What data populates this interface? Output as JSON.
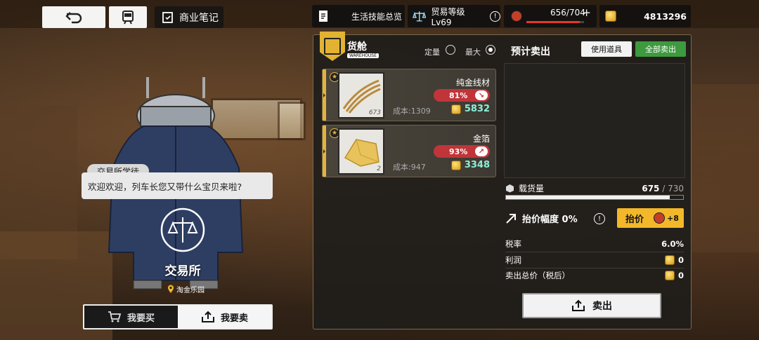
{
  "nav": {
    "back_icon": "undo-arrow-icon",
    "train_icon": "train-icon",
    "notes_label": "商业笔记"
  },
  "topbar": {
    "life_skills": "生活技能总览",
    "trade_level": "贸易等级Lv69",
    "fatigue_text": "656/704",
    "fatigue_fraction": 0.93,
    "currency": "4813296"
  },
  "character": {
    "speaker": "交易所学徒",
    "dialogue": "欢迎欢迎，列车长您又带什么宝贝来啦?",
    "station_name": "交易所",
    "location": "淘金乐园"
  },
  "mode": {
    "buy_label": "我要买",
    "sell_label": "我要卖",
    "active": "sell"
  },
  "warehouse": {
    "title": "货舱",
    "subtitle": "WAREHOUSE",
    "fixed_label": "定量",
    "max_label": "最大",
    "selected_radio": "最大"
  },
  "items": [
    {
      "name": "纯金线材",
      "quantity": "673",
      "pct": "81%",
      "trend": "down",
      "cost": "成本:1309",
      "price": "5832"
    },
    {
      "name": "金箔",
      "quantity": "2",
      "pct": "93%",
      "trend": "up",
      "cost": "成本:947",
      "price": "3348"
    }
  ],
  "sale": {
    "preview_title": "预计卖出",
    "use_item_label": "使用道具",
    "sell_all_label": "全部卖出",
    "cargo_label": "载货量",
    "cargo_current": "675",
    "cargo_max": "730",
    "cargo_fraction": 0.925,
    "bargain_label": "抬价幅度 0%",
    "bargain_button": "抬价",
    "bargain_bonus": "+8",
    "tax_label": "税率",
    "tax_value": "6.0%",
    "profit_label": "利润",
    "profit_value": "0",
    "total_label": "卖出总价（税后）",
    "total_value": "0",
    "sell_button": "卖出"
  }
}
